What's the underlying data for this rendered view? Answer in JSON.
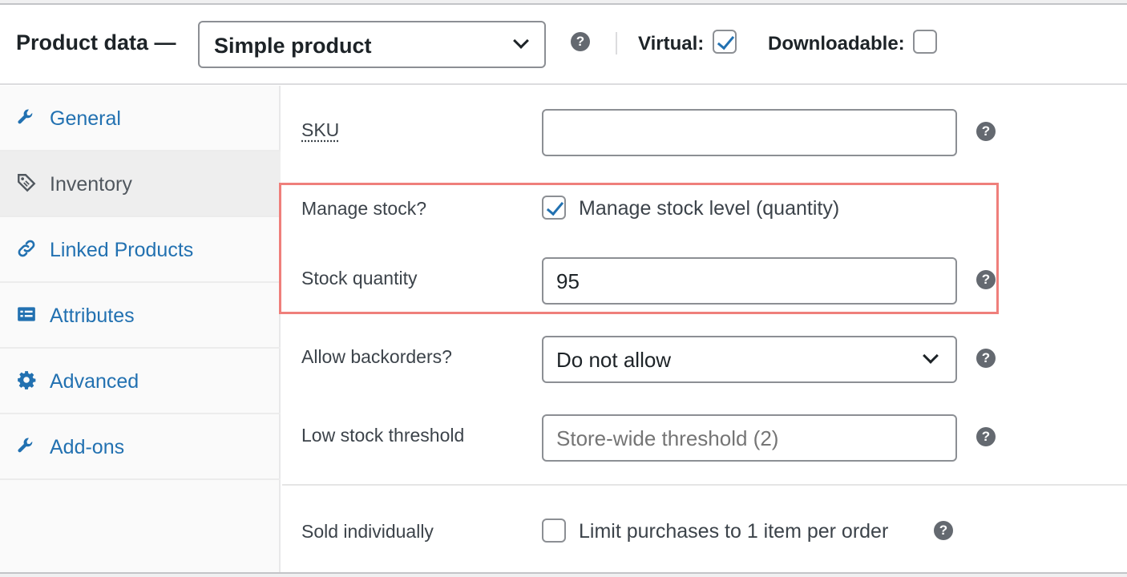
{
  "header": {
    "title": "Product data —",
    "product_type": "Simple product",
    "virtual_label": "Virtual:",
    "virtual_checked": true,
    "downloadable_label": "Downloadable:",
    "downloadable_checked": false,
    "help_icon": "help-icon"
  },
  "sidebar": {
    "items": [
      {
        "label": "General",
        "icon": "wrench-icon",
        "active": false
      },
      {
        "label": "Inventory",
        "icon": "tag-icon",
        "active": true
      },
      {
        "label": "Linked Products",
        "icon": "link-icon",
        "active": false
      },
      {
        "label": "Attributes",
        "icon": "list-icon",
        "active": false
      },
      {
        "label": "Advanced",
        "icon": "gear-icon",
        "active": false
      },
      {
        "label": "Add-ons",
        "icon": "wrench-icon",
        "active": false
      }
    ]
  },
  "inventory": {
    "sku": {
      "label": "SKU",
      "value": ""
    },
    "manage_stock": {
      "label": "Manage stock?",
      "checkbox_label": "Manage stock level (quantity)",
      "checked": true
    },
    "stock_quantity": {
      "label": "Stock quantity",
      "value": "95"
    },
    "backorders": {
      "label": "Allow backorders?",
      "value": "Do not allow"
    },
    "low_stock": {
      "label": "Low stock threshold",
      "placeholder": "Store-wide threshold (2)"
    },
    "sold_individually": {
      "label": "Sold individually",
      "checkbox_label": "Limit purchases to 1 item per order",
      "checked": false
    }
  },
  "colors": {
    "accent": "#2271b1",
    "highlight": "#ef7f7b",
    "help_icon_bg": "#646970"
  }
}
